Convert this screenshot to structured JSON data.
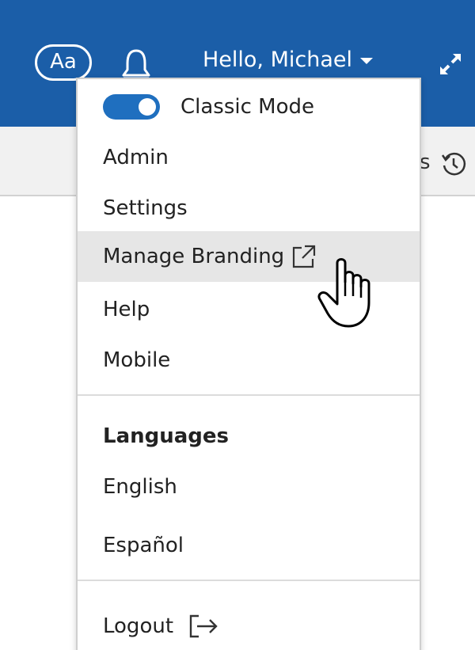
{
  "header": {
    "font_button_label": "Aa",
    "bell_icon": "bell-icon",
    "greeting": "Hello, Michael",
    "collapse_icon": "collapse-arrows-icon"
  },
  "subbar": {
    "partial_text": "s",
    "history_icon": "history-icon"
  },
  "menu": {
    "classic_mode": {
      "label": "Classic Mode",
      "enabled": true
    },
    "items": [
      {
        "label": "Admin"
      },
      {
        "label": "Settings"
      },
      {
        "label": "Manage Branding",
        "icon": "external-link-icon",
        "hovered": true
      },
      {
        "label": "Help"
      },
      {
        "label": "Mobile"
      }
    ],
    "languages": {
      "heading": "Languages",
      "options": [
        {
          "label": "English"
        },
        {
          "label": "Español"
        }
      ]
    },
    "logout": {
      "label": "Logout",
      "icon": "logout-icon"
    }
  },
  "colors": {
    "header_blue": "#1b5ea8",
    "toggle_blue": "#1f6fbf",
    "hover_grey": "#e6e6e6"
  },
  "cursor": "hand-pointer-cursor"
}
